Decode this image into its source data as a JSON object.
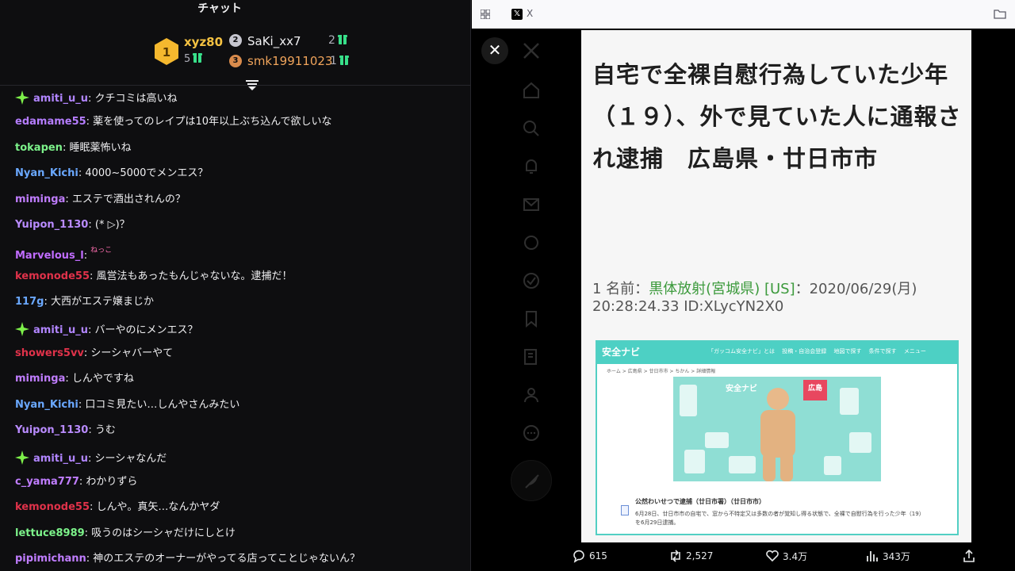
{
  "chat": {
    "header_title": "チャット",
    "leaderboard": {
      "rank1": {
        "rank": "1",
        "name": "xyz80",
        "count": "5"
      },
      "rank2": {
        "rank": "2",
        "name": "SaKi_xx7",
        "count": "2"
      },
      "rank3": {
        "rank": "3",
        "name": "smk19911023",
        "count": "1"
      }
    },
    "messages": [
      {
        "user": "amiti_u_u",
        "color": "#b185ff",
        "text": ": クチコミは高いね",
        "badge": true
      },
      {
        "user": "edamame55",
        "color": "#b57dff",
        "text": ": 薬を使ってのレイプは10年以上ぶち込んで欲しいな"
      },
      {
        "user": "tokapen",
        "color": "#7cf28a",
        "text": ": 睡眠薬怖いね"
      },
      {
        "user": "Nyan_Kichi",
        "color": "#6aa8ff",
        "text": ": 4000~5000でメンエス？"
      },
      {
        "user": "mimingа",
        "color": "#c07dff",
        "text": ": エステで酒出されんの？"
      },
      {
        "user": "Yuipon_1130",
        "color": "#b98bff",
        "text": ": (* ▷)？"
      },
      {
        "user": "Marvelous_l",
        "color": "#c06cff",
        "text": ":",
        "emote": "ねっこ"
      },
      {
        "user": "kemonode55",
        "color": "#e0324a",
        "text": ": 風営法もあったもんじゃないな。逮捕だ！"
      },
      {
        "user": "117g",
        "color": "#6aa8ff",
        "text": ": 大西がエステ嬢まじか"
      },
      {
        "user": "amiti_u_u",
        "color": "#b185ff",
        "text": ": バーやのにメンエス？",
        "badge": true
      },
      {
        "user": "showers5vv",
        "color": "#e0324a",
        "text": ": シーシャバーやて"
      },
      {
        "user": "mimingа",
        "color": "#c07dff",
        "text": ": しんやですね"
      },
      {
        "user": "Nyan_Kichi",
        "color": "#6aa8ff",
        "text": ": 口コミ見たい…しんやさんみたい"
      },
      {
        "user": "Yuipon_1130",
        "color": "#b98bff",
        "text": ": うむ"
      },
      {
        "user": "amiti_u_u",
        "color": "#b185ff",
        "text": ": シーシャなんだ",
        "badge": true
      },
      {
        "user": "c_yama777",
        "color": "#c07dff",
        "text": ": わかりずら"
      },
      {
        "user": "kemonode55",
        "color": "#e0324a",
        "text": ": しんや。真矢…なんかヤダ"
      },
      {
        "user": "lettuce8989",
        "color": "#7cf28a",
        "text": ": 吸うのはシーシャだけにしとけ"
      },
      {
        "user": "pipimichann",
        "color": "#c07dff",
        "text": ": 神のエステのオーナーがやってる店ってことじゃないん？"
      }
    ]
  },
  "browser": {
    "tab_title": "X",
    "close_label": "✕",
    "article": {
      "title": "自宅で全裸自慰行為していた少年（１９）、外で見ていた人に通報され逮捕　広島県・廿日市市",
      "meta_prefix": "1 名前：",
      "meta_name": "黒体放射(宮城県) [US]",
      "meta_suffix": "：2020/06/29(月) 20:28:24.33 ID:XLycYN2X0",
      "site": {
        "logo": "安全ナビ",
        "menu": "「ガッコム安全ナビ」とは　 投稿・自治会登録　 地図で探す　 条件で探す　 メニュー",
        "crumb": "ホーム > 広島県 > 廿日市市 > ちかん > 詳細情報",
        "flag": "広島",
        "hero_logo": "安全ナビ",
        "headline": "公然わいせつで逮捕（廿日市署）（廿日市市）",
        "body": "6月28日、廿日市市の自宅で、窓から不特定又は多数の者が覚知し得る状態で、全裸で自慰行為を行った少年（19）を6月29日逮捕。"
      }
    },
    "actions": {
      "replies": "615",
      "reposts": "2,527",
      "likes": "3.4万",
      "views": "343万"
    }
  }
}
